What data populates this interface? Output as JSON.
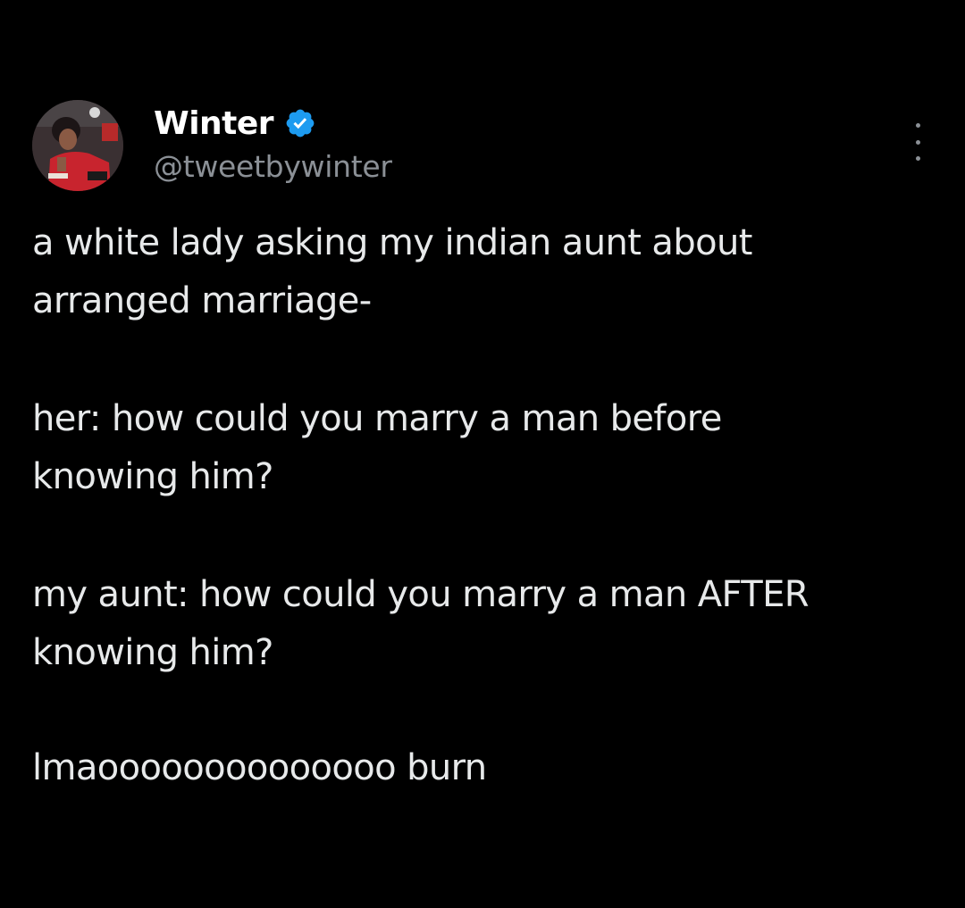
{
  "tweet": {
    "author": {
      "display_name": "Winter",
      "handle": "@tweetbywinter",
      "verified_icon": "verified-badge-icon",
      "avatar_icon": "profile-photo"
    },
    "more_icon": "more-options-icon",
    "paragraphs": [
      {
        "lines": [
          "a white lady asking my indian aunt about",
          "arranged marriage-"
        ]
      },
      {
        "lines": [
          "her: how could you marry a man before",
          "knowing him?"
        ]
      },
      {
        "lines": [
          "my aunt: how could you marry a man AFTER",
          "knowing him?"
        ]
      },
      {
        "lines": [
          "lmaoooooooooooooo burn"
        ]
      }
    ]
  },
  "colors": {
    "background": "#000000",
    "name": "#ffffff",
    "text": "#e7e9ea",
    "secondary": "#8b9096",
    "verified": "#1d9bf0"
  }
}
